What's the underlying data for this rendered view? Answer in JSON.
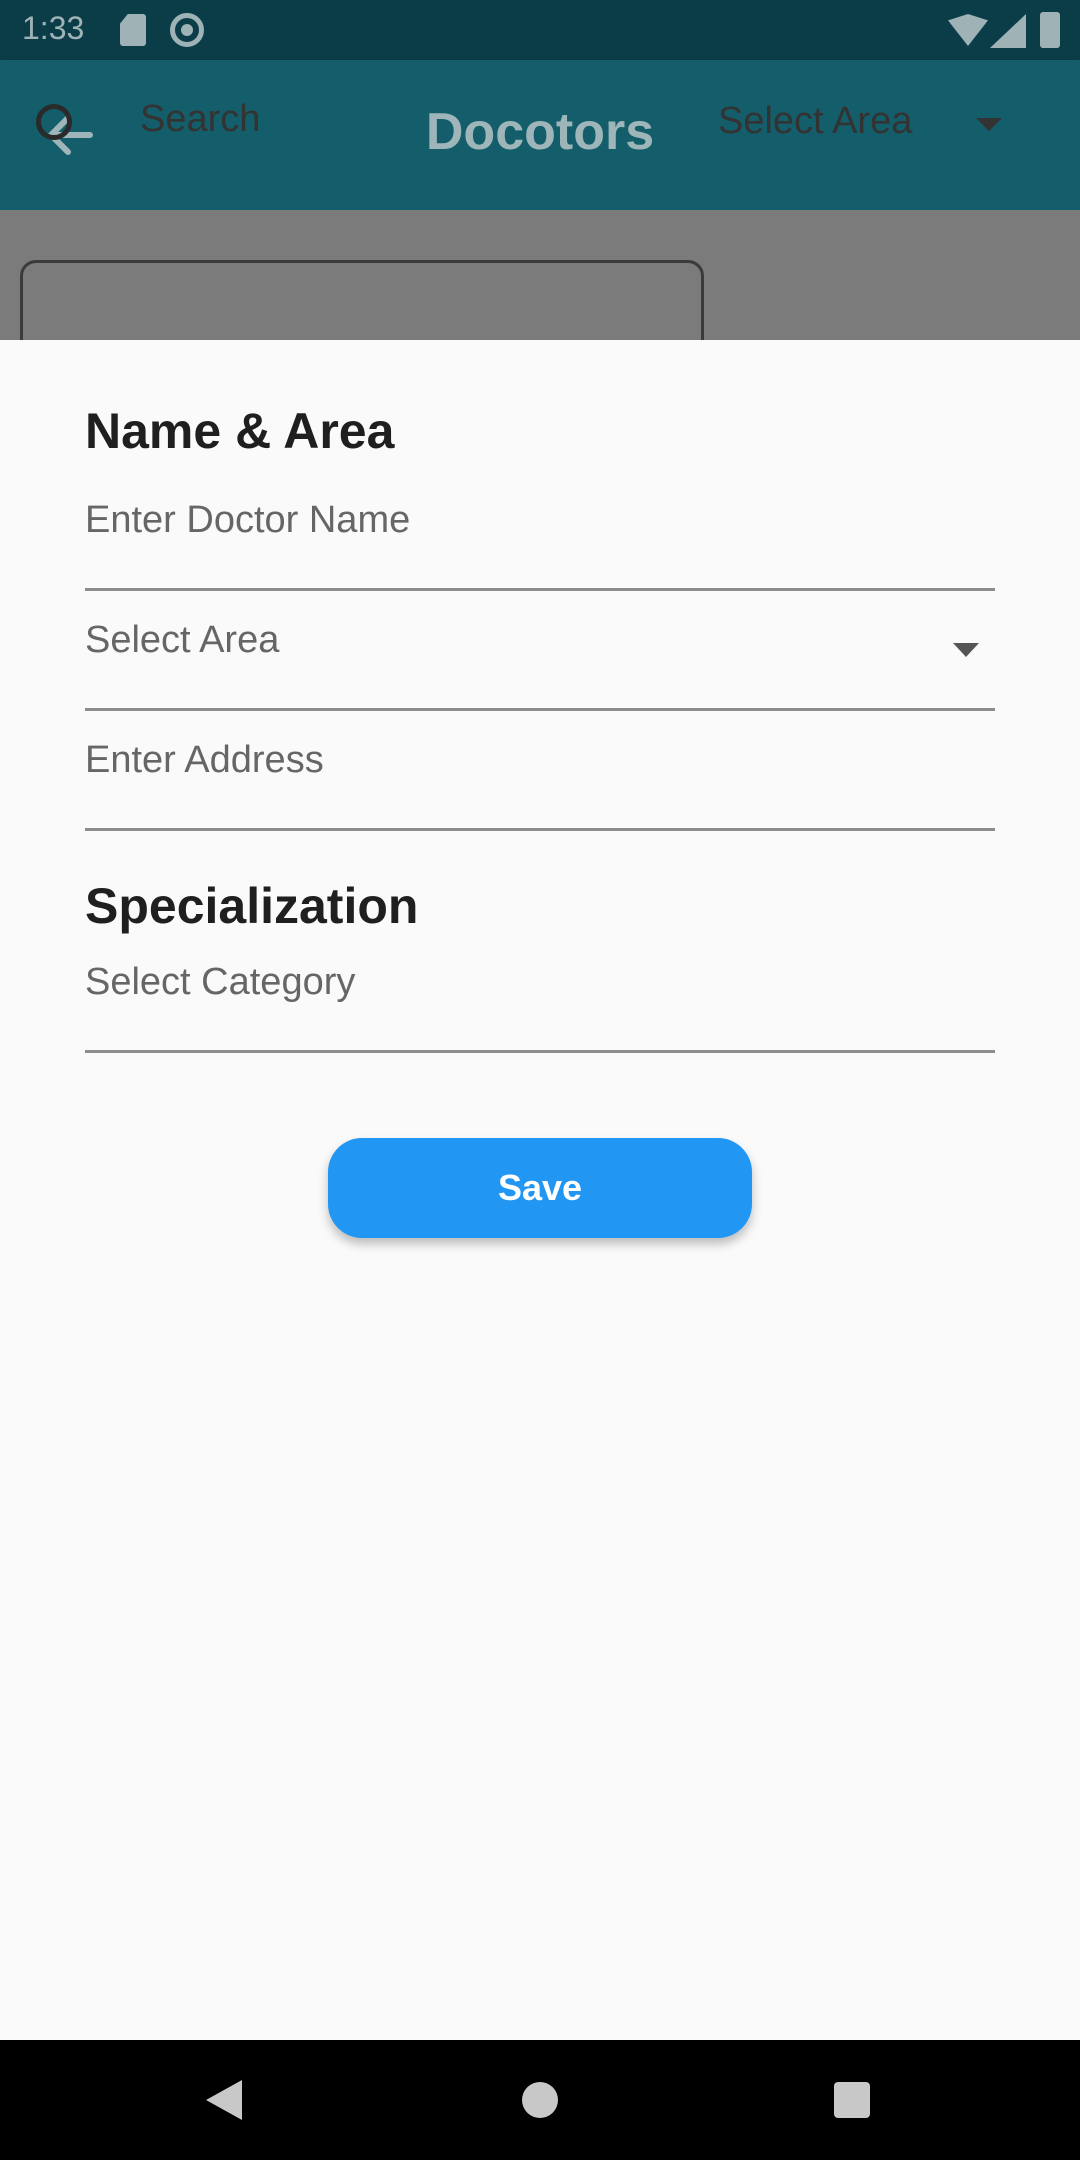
{
  "status_bar": {
    "time": "1:33"
  },
  "app_bar": {
    "title": "Docotors"
  },
  "background": {
    "search_placeholder": "Search",
    "area_label": "Select Area"
  },
  "sheet": {
    "name_area_title": "Name & Area",
    "doctor_name_placeholder": "Enter Doctor Name",
    "area_dropdown_label": "Select Area",
    "address_placeholder": "Enter Address",
    "specialization_title": "Specialization",
    "category_label": "Select Category",
    "save_label": "Save"
  },
  "colors": {
    "app_bar": "#135e6a",
    "save_button": "#2196f3",
    "sheet_bg": "#fafafa"
  }
}
